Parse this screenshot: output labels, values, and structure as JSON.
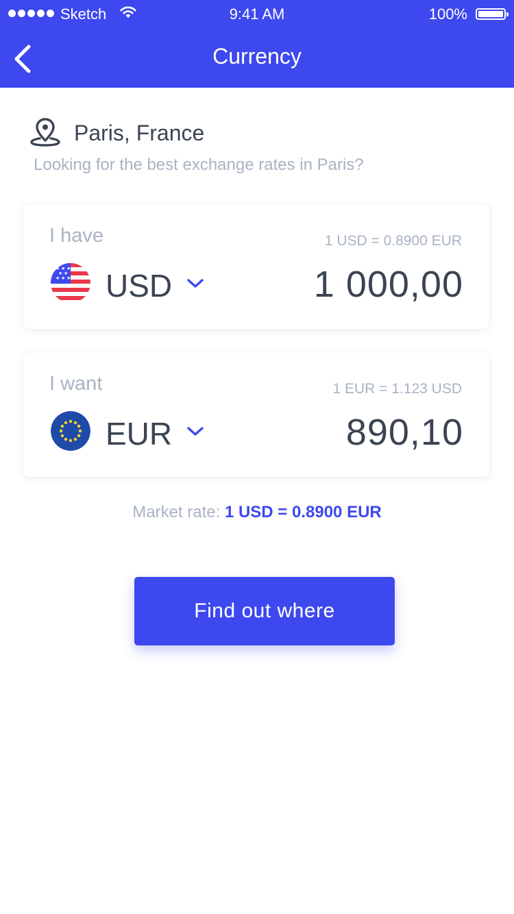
{
  "status_bar": {
    "carrier": "Sketch",
    "time": "9:41 AM",
    "battery": "100%"
  },
  "nav": {
    "title": "Currency",
    "back_icon": "chevron-left-icon"
  },
  "location": {
    "icon": "map-pin-icon",
    "name": "Paris, France",
    "subtitle": "Looking for the best exchange rates in Paris?"
  },
  "have": {
    "label": "I have",
    "rate": "1 USD = 0.8900 EUR",
    "flag": "us-flag-icon",
    "currency": "USD",
    "amount": "1 000,00"
  },
  "want": {
    "label": "I want",
    "rate": "1 EUR = 1.123 USD",
    "flag": "eu-flag-icon",
    "currency": "EUR",
    "amount": "890,10"
  },
  "market": {
    "label": "Market rate:",
    "value": "1 USD = 0.8900 EUR"
  },
  "cta": {
    "label": "Find out where"
  },
  "colors": {
    "accent": "#3d48ee",
    "muted": "#a9b3c3",
    "text": "#3b4453"
  }
}
